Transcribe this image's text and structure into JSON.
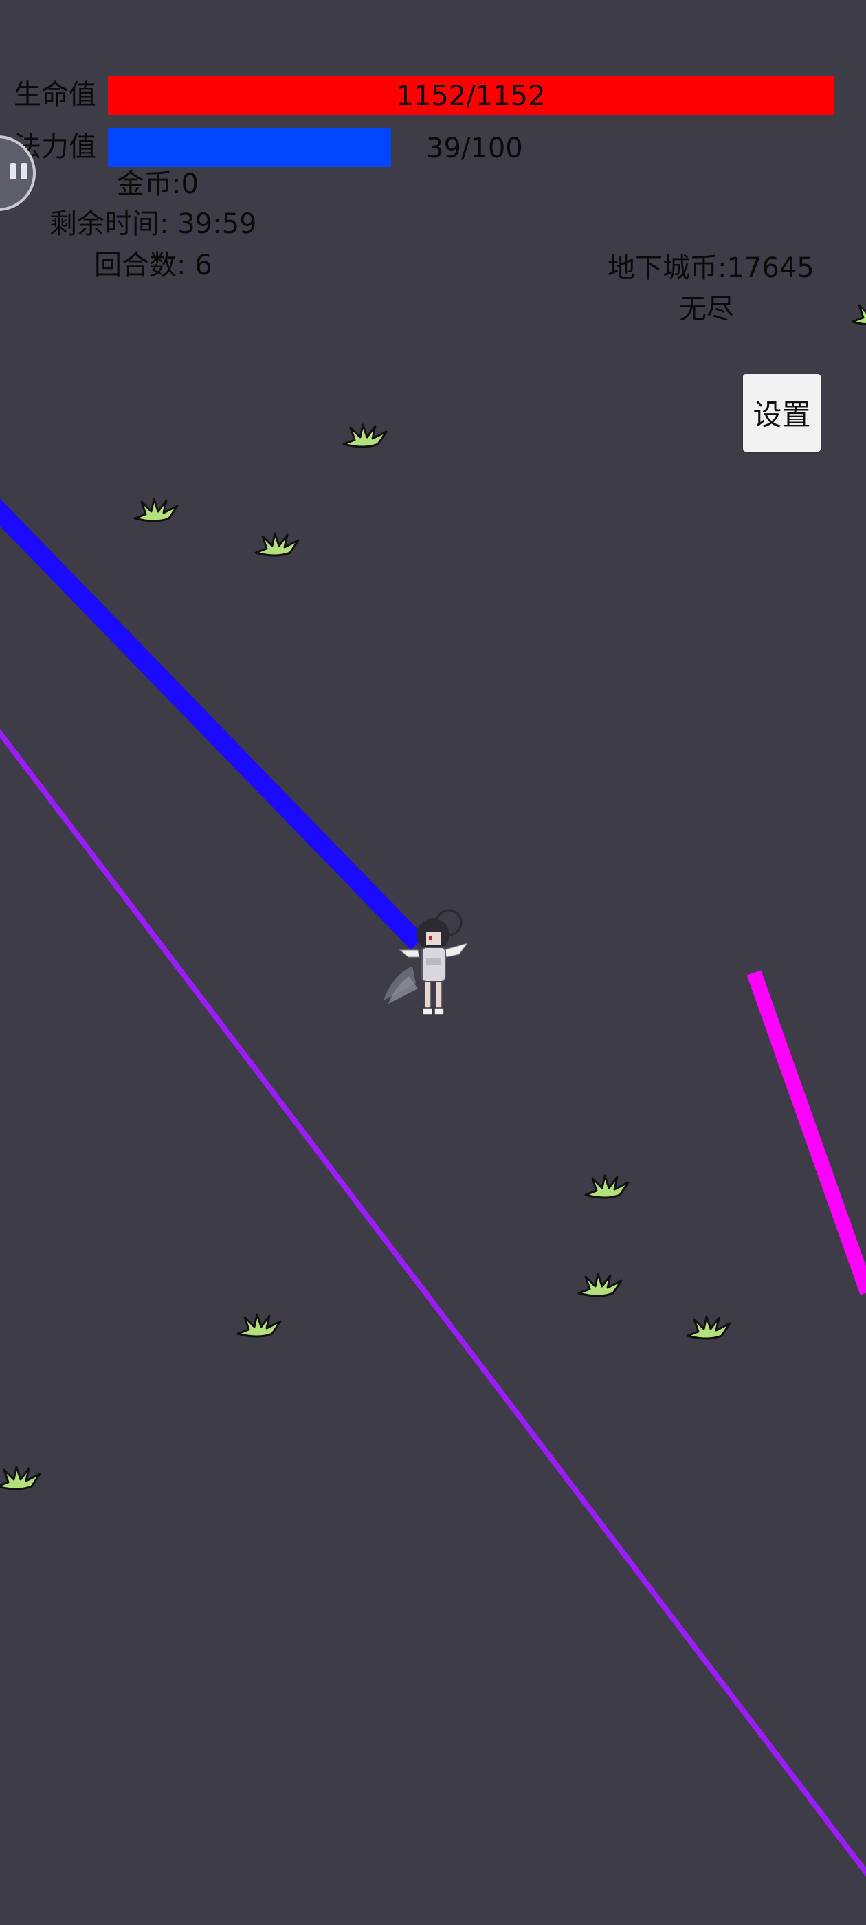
{
  "hud": {
    "hp_label": "生命值",
    "hp_text": "1152/1152",
    "hp_current": 1152,
    "hp_max": 1152,
    "mp_label": "法力值",
    "mp_text": "39/100",
    "mp_current": 39,
    "mp_max": 100,
    "gold": "金币:0",
    "time_left": "剩余时间: 39:59",
    "round": "回合数: 6",
    "dungeon_coins": "地下城币:17645",
    "mode": "无尽",
    "settings_label": "设置"
  },
  "icons": {
    "pause": "pause-icon",
    "grass": "grass-tuft-icon",
    "player": "angel-girl-character"
  },
  "colors": {
    "background": "#3d3c47",
    "hp_bar": "#ff0000",
    "mp_bar": "#0047ff",
    "beam_blue": "#1a0bff",
    "beam_purple": "#9b1cff",
    "beam_magenta": "#ff00ff",
    "grass": "#b3e07a"
  }
}
